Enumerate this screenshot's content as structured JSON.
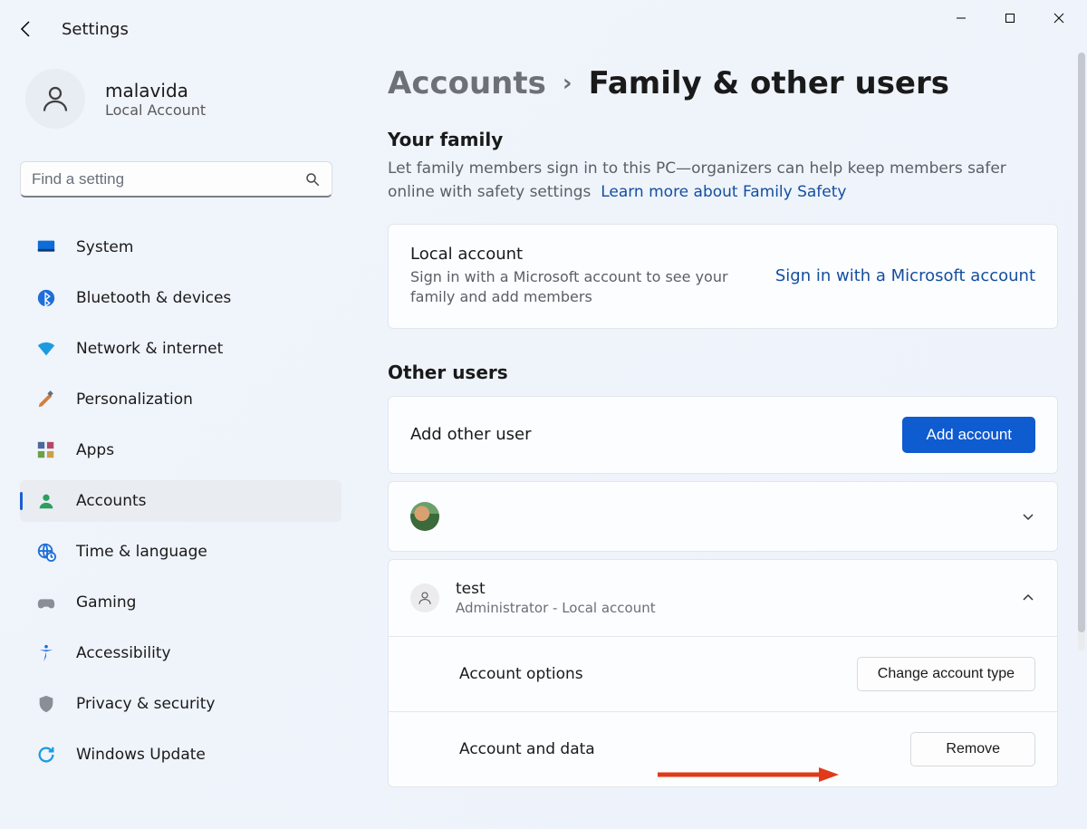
{
  "app": {
    "title": "Settings"
  },
  "titlebar": {
    "min": "minimize",
    "max": "maximize",
    "close": "close"
  },
  "user": {
    "name": "malavida",
    "sub": "Local Account"
  },
  "search": {
    "placeholder": "Find a setting"
  },
  "nav": {
    "items": [
      {
        "id": "system",
        "label": "System"
      },
      {
        "id": "bluetooth",
        "label": "Bluetooth & devices"
      },
      {
        "id": "network",
        "label": "Network & internet"
      },
      {
        "id": "personalization",
        "label": "Personalization"
      },
      {
        "id": "apps",
        "label": "Apps"
      },
      {
        "id": "accounts",
        "label": "Accounts"
      },
      {
        "id": "time",
        "label": "Time & language"
      },
      {
        "id": "gaming",
        "label": "Gaming"
      },
      {
        "id": "accessibility",
        "label": "Accessibility"
      },
      {
        "id": "privacy",
        "label": "Privacy & security"
      },
      {
        "id": "update",
        "label": "Windows Update"
      }
    ],
    "selected": "accounts"
  },
  "breadcrumb": {
    "parent": "Accounts",
    "current": "Family & other users"
  },
  "family": {
    "title": "Your family",
    "sub": "Let family members sign in to this PC—organizers can help keep members safer online with safety settings",
    "link": "Learn more about Family Safety",
    "card_title": "Local account",
    "card_sub": "Sign in with a Microsoft account to see your family and add members",
    "card_action": "Sign in with a Microsoft account"
  },
  "other": {
    "title": "Other users",
    "add_label": "Add other user",
    "add_button": "Add account",
    "users": [
      {
        "name": "",
        "desc": "",
        "expanded": false,
        "photo": true
      },
      {
        "name": "test",
        "desc": "Administrator - Local account",
        "expanded": true,
        "photo": false
      }
    ],
    "details": {
      "options_label": "Account options",
      "options_button": "Change account type",
      "data_label": "Account and data",
      "data_button": "Remove"
    }
  }
}
